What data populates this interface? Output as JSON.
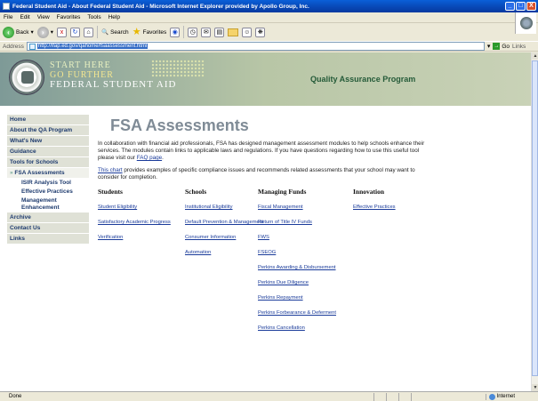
{
  "window": {
    "title": "Federal Student Aid - About Federal Student Aid - Microsoft Internet Explorer provided by Apollo Group, Inc.",
    "min": "_",
    "max": "□",
    "close": "X"
  },
  "menu": [
    "File",
    "Edit",
    "View",
    "Favorites",
    "Tools",
    "Help"
  ],
  "toolbar": {
    "back": "Back",
    "search": "Search",
    "favorites": "Favorites"
  },
  "address": {
    "label": "Address",
    "url": "http://ifap.ed.gov/qahome/fsaassessment.html",
    "go": "Go",
    "links": "Links"
  },
  "header": {
    "line1": "START HERE",
    "line2": "GO FURTHER",
    "line3": "FEDERAL STUDENT AID",
    "program": "Quality Assurance Program"
  },
  "sidebar": {
    "items": [
      {
        "label": "Home"
      },
      {
        "label": "About the QA Program"
      },
      {
        "label": "What's New"
      },
      {
        "label": "Guidance"
      },
      {
        "label": "Tools for Schools"
      },
      {
        "label": "FSA Assessments"
      },
      {
        "label": "ISIR Analysis Tool"
      },
      {
        "label": "Effective Practices"
      },
      {
        "label": "Management Enhancement"
      },
      {
        "label": "Archive"
      },
      {
        "label": "Contact Us"
      },
      {
        "label": "Links"
      }
    ]
  },
  "main": {
    "title": "FSA Assessments",
    "intro": "In collaboration with financial aid professionals, FSA has designed management assessment modules to help schools enhance their services. The modules contain links to applicable laws and regulations. If you have questions regarding how to use this useful tool please visit our",
    "faq_link": "FAQ page",
    "intro_end": ".",
    "chart_link": "This chart",
    "chart_text": " provides examples of specific compliance issues and recommends related assessments that your school may want to consider for completion.",
    "columns": [
      {
        "heading": "Students",
        "links": [
          "Student Eligibility",
          "Satisfactory Academic Progress",
          "Verification"
        ]
      },
      {
        "heading": "Schools",
        "links": [
          "Institutional Eligibility",
          "Default Prevention & Management",
          "Consumer Information",
          "Automation"
        ]
      },
      {
        "heading": "Managing Funds",
        "links": [
          "Fiscal Management",
          "Return of Title IV Funds",
          "FWS",
          "FSEOG",
          "Perkins Awarding & Disbursement",
          "Perkins Due Diligence",
          "Perkins Repayment",
          "Perkins Forbearance & Deferment",
          "Perkins Cancellation"
        ]
      },
      {
        "heading": "Innovation",
        "links": [
          "Effective Practices"
        ]
      }
    ]
  },
  "status": {
    "text": "Done",
    "zone": "Internet"
  }
}
